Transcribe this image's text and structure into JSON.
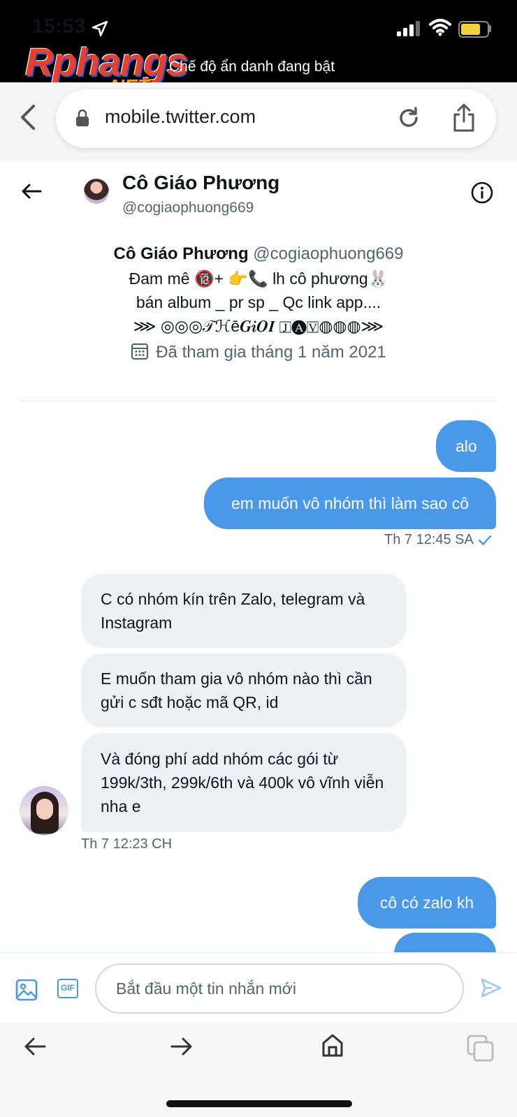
{
  "status_bar": {
    "time": "15:53",
    "incognito_text": "Chế độ ẩn danh đang bật",
    "battery_color": "#f2d13c"
  },
  "watermark": {
    "logo": "Rphangs",
    "logo_suffix": ".NET"
  },
  "browser": {
    "url": "mobile.twitter.com"
  },
  "conversation_header": {
    "name": "Cô Giáo Phương",
    "handle": "@cogiaophuong669"
  },
  "profile": {
    "name": "Cô Giáo Phương",
    "handle": "@cogiaophuong669",
    "bio_line1": "Đam mê 🔞+ 👉📞 lh cô phương🐰",
    "bio_line2": "bán album _ pr sp _ Qc link app....",
    "bio_line3": "⋙ ◎◎◎𝒯ℋē𝑮𝒊𝑶𝑰 🄹🅐🅅◍◍◍⋙",
    "joined": "Đã tham gia tháng 1 năm 2021"
  },
  "messages": [
    {
      "dir": "out",
      "text": "alo"
    },
    {
      "dir": "out",
      "text": "em muốn vô nhóm thì làm sao cô"
    },
    {
      "dir": "in",
      "text": "C có nhóm kín trên Zalo, telegram và Instagram"
    },
    {
      "dir": "in",
      "text": "E muốn tham gia vô nhóm nào thì cần gửi c sđt hoặc mã QR, id"
    },
    {
      "dir": "in",
      "text": "Và đóng phí add nhóm các gói từ 199k/3th, 299k/6th và 400k vô vĩnh viễn nha e"
    },
    {
      "dir": "out",
      "text": "cô có zalo kh"
    }
  ],
  "timestamps": {
    "out_1": "Th 7 12:45 SA",
    "in_1": "Th 7 12:23 CH"
  },
  "composer": {
    "placeholder": "Bắt đầu một tin nhắn mới",
    "gif_label": "GIF"
  },
  "colors": {
    "accent": "#4a99e9",
    "incoming_bubble": "#eef1f3"
  }
}
